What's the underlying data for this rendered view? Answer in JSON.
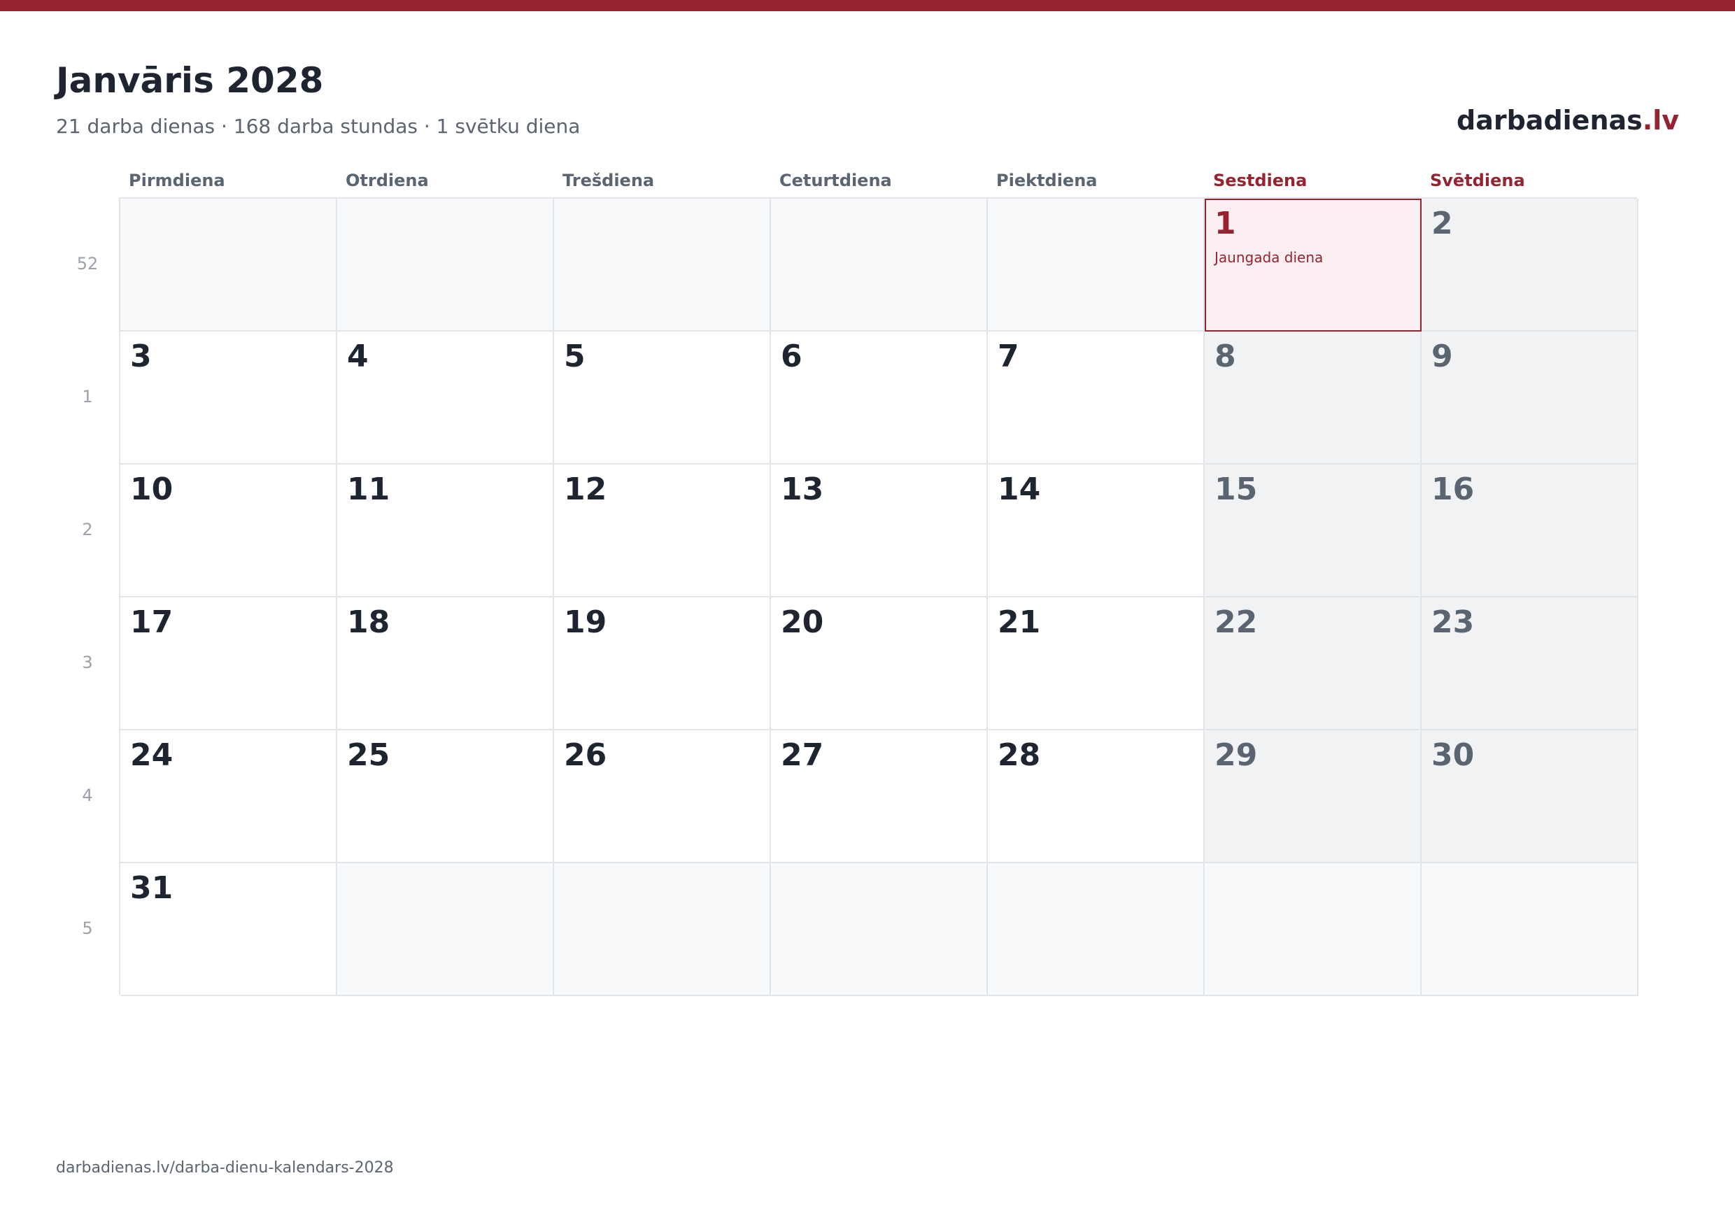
{
  "header": {
    "title": "Janvāris 2028",
    "summary": "21 darba dienas · 168 darba stundas · 1 svētku diena",
    "brand_name": "darbadienas",
    "brand_tld": ".lv"
  },
  "weekdays": [
    "Pirmdiena",
    "Otrdiena",
    "Trešdiena",
    "Ceturtdiena",
    "Piektdiena",
    "Sestdiena",
    "Svētdiena"
  ],
  "week_numbers": [
    "52",
    "1",
    "2",
    "3",
    "4",
    "5"
  ],
  "days": [
    "",
    "",
    "",
    "",
    "",
    "1",
    "2",
    "3",
    "4",
    "5",
    "6",
    "7",
    "8",
    "9",
    "10",
    "11",
    "12",
    "13",
    "14",
    "15",
    "16",
    "17",
    "18",
    "19",
    "20",
    "21",
    "22",
    "23",
    "24",
    "25",
    "26",
    "27",
    "28",
    "29",
    "30",
    "31",
    "",
    "",
    "",
    "",
    "",
    ""
  ],
  "holiday": {
    "day": "1",
    "name": "Jaungada diena"
  },
  "footer": {
    "url": "darbadienas.lv/darba-dienu-kalendars-2028"
  },
  "colors": {
    "accent": "#952330",
    "weekend_bg": "#f1f2f4",
    "holiday_bg": "#fbeff1"
  }
}
